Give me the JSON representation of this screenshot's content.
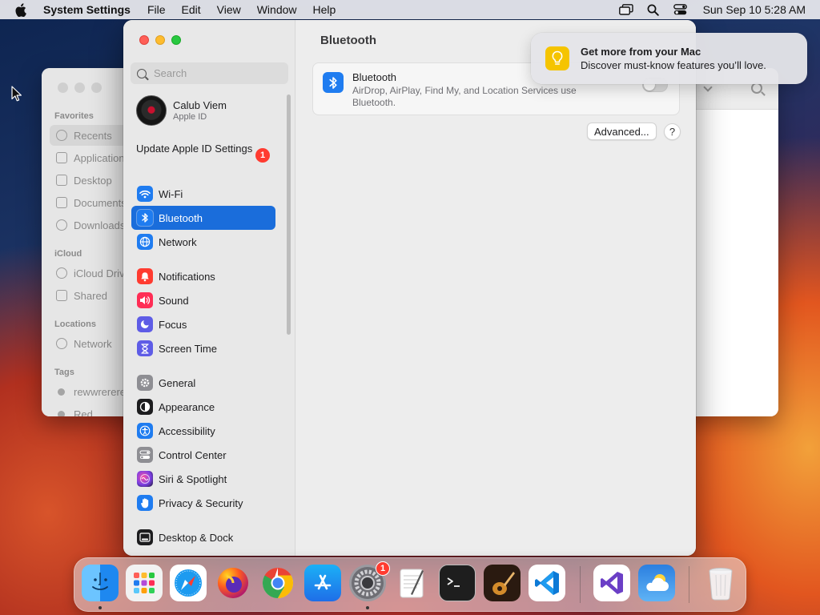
{
  "colors": {
    "accent": "#1a6ddb",
    "badge": "#ff3b30",
    "bluetooth": "#1f7cf0",
    "close": "#ff5f57",
    "minimize": "#febc2e",
    "zoom": "#28c840"
  },
  "menubar": {
    "apple_icon": "apple-logo-icon",
    "app_name": "System Settings",
    "menus": [
      "File",
      "Edit",
      "View",
      "Window",
      "Help"
    ],
    "status_icons": [
      "screen-mirroring-icon",
      "spotlight-search-icon",
      "control-center-icon"
    ],
    "clock": "Sun Sep 10  5:28 AM"
  },
  "finder": {
    "sections": {
      "favorites": "Favorites",
      "icloud": "iCloud",
      "locations": "Locations",
      "tags": "Tags"
    },
    "items": [
      "Recents",
      "Applications",
      "Desktop",
      "Documents",
      "Downloads",
      "iCloud Drive",
      "Shared",
      "Network",
      "rewwrerere",
      "Red"
    ]
  },
  "settings": {
    "search_placeholder": "Search",
    "account": {
      "name": "Calub Viem",
      "sub": "Apple ID"
    },
    "update": {
      "label": "Update Apple ID Settings",
      "badge": "1"
    },
    "nav": [
      {
        "label": "Wi-Fi",
        "icon": "wifi-icon",
        "color": "#1f7cf0"
      },
      {
        "label": "Bluetooth",
        "icon": "bluetooth-icon",
        "color": "#1f7cf0"
      },
      {
        "label": "Network",
        "icon": "globe-icon",
        "color": "#1f7cf0"
      },
      {
        "label": "Notifications",
        "icon": "bell-icon",
        "color": "#ff3b30"
      },
      {
        "label": "Sound",
        "icon": "speaker-icon",
        "color": "#ff2d55"
      },
      {
        "label": "Focus",
        "icon": "moon-icon",
        "color": "#5e5ce6"
      },
      {
        "label": "Screen Time",
        "icon": "hourglass-icon",
        "color": "#5e5ce6"
      },
      {
        "label": "General",
        "icon": "gear-icon",
        "color": "#8e8e93"
      },
      {
        "label": "Appearance",
        "icon": "appearance-icon",
        "color": "#1c1c1e"
      },
      {
        "label": "Accessibility",
        "icon": "accessibility-icon",
        "color": "#1f7cf0"
      },
      {
        "label": "Control Center",
        "icon": "control-center-icon",
        "color": "#8e8e93"
      },
      {
        "label": "Siri & Spotlight",
        "icon": "siri-icon",
        "color": "#b44ad9"
      },
      {
        "label": "Privacy & Security",
        "icon": "hand-icon",
        "color": "#1f7cf0"
      },
      {
        "label": "Desktop & Dock",
        "icon": "dock-icon",
        "color": "#1c1c1e"
      }
    ],
    "selected": "Bluetooth",
    "main": {
      "title": "Bluetooth",
      "card_title": "Bluetooth",
      "card_desc": "AirDrop, AirPlay, Find My, and Location Services use Bluetooth.",
      "toggle_on": false,
      "advanced_label": "Advanced...",
      "help_label": "?"
    }
  },
  "notification": {
    "icon": "lightbulb-icon",
    "title": "Get more from your Mac",
    "body": "Discover must-know features you’ll love."
  },
  "dock": {
    "apps": [
      {
        "name": "Finder",
        "icon": "finder-icon",
        "running": true
      },
      {
        "name": "Launchpad",
        "icon": "launchpad-icon",
        "running": false
      },
      {
        "name": "Safari",
        "icon": "safari-icon",
        "running": false
      },
      {
        "name": "Firefox",
        "icon": "firefox-icon",
        "running": false
      },
      {
        "name": "Chrome",
        "icon": "chrome-icon",
        "running": false
      },
      {
        "name": "App Store",
        "icon": "app-store-icon",
        "running": false
      },
      {
        "name": "System Settings",
        "icon": "system-settings-icon",
        "running": true,
        "badge": "1"
      },
      {
        "name": "TextEdit",
        "icon": "textedit-icon",
        "running": false
      },
      {
        "name": "Terminal",
        "icon": "terminal-icon",
        "running": false
      },
      {
        "name": "GarageBand",
        "icon": "garageband-icon",
        "running": false
      },
      {
        "name": "Visual Studio Code",
        "icon": "vscode-icon",
        "running": false
      },
      {
        "name": "Visual Studio",
        "icon": "visual-studio-icon",
        "running": false
      },
      {
        "name": "Weather",
        "icon": "weather-icon",
        "running": false
      },
      {
        "name": "Trash",
        "icon": "trash-icon",
        "running": false
      }
    ]
  }
}
